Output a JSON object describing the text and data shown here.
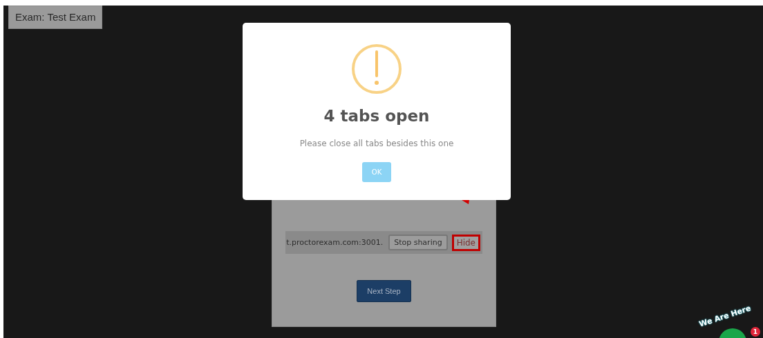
{
  "exam_label": "Exam: Test Exam",
  "share_panel": {
    "share_bar": {
      "text": "t.proctorexam.com:3001.",
      "stop_button": "Stop sharing",
      "hide_button": "Hide"
    },
    "next_button": "Next Step"
  },
  "dialog": {
    "title": "4 tabs open",
    "message": "Please close all tabs besides this one",
    "ok_button": "OK"
  },
  "chat_widget": {
    "caption": "We Are Here",
    "badge": "1"
  }
}
